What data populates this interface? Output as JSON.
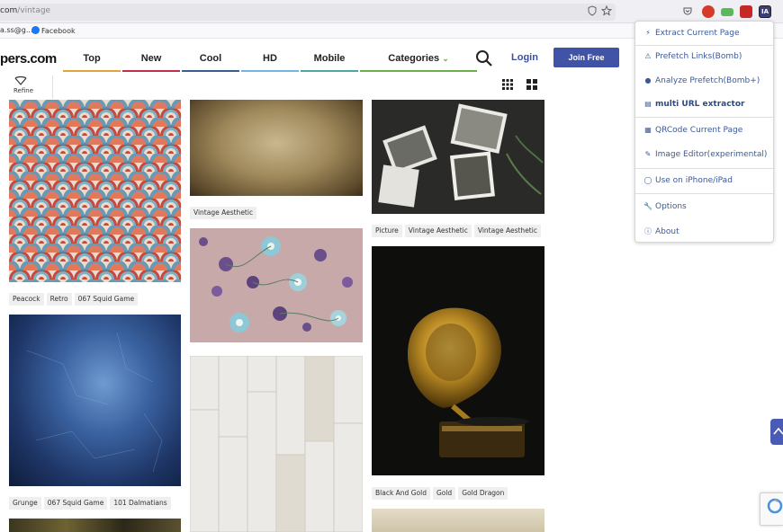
{
  "browser": {
    "url_host": "com",
    "url_path": "/vintage",
    "bookmarks": [
      "a.ss@g...",
      "Facebook"
    ]
  },
  "site": {
    "logo": "pers.com",
    "nav": [
      {
        "label": "Top",
        "color": "#e4a33a"
      },
      {
        "label": "New",
        "color": "#c0304a"
      },
      {
        "label": "Cool",
        "color": "#3a5e8f"
      },
      {
        "label": "HD",
        "color": "#73b4e0"
      },
      {
        "label": "Mobile",
        "color": "#4fa8a0"
      },
      {
        "label": "Categories",
        "color": "#6ab04c"
      }
    ],
    "login": "Login",
    "join": "Join Free",
    "refine": "Refine",
    "accent": "#4153a6"
  },
  "gallery": {
    "col1": [
      {
        "name": "peacock",
        "tags": [
          "Peacock",
          "Retro",
          "067 Squid Game"
        ]
      },
      {
        "name": "grunge",
        "tags": [
          "Grunge",
          "067 Squid Game",
          "101 Dalmatians"
        ]
      }
    ],
    "col2": [
      {
        "name": "parchment",
        "tags": [
          "Vintage Aesthetic"
        ]
      },
      {
        "name": "floral",
        "tags": []
      },
      {
        "name": "wood",
        "tags": []
      }
    ],
    "col3": [
      {
        "name": "photos",
        "tags": [
          "Picture",
          "Vintage Aesthetic",
          "Vintage Aesthetic"
        ]
      },
      {
        "name": "gramophone",
        "tags": [
          "Black And Gold",
          "Gold",
          "Gold Dragon"
        ]
      }
    ]
  },
  "ext_menu": {
    "items": [
      {
        "label": "Extract Current Page",
        "icon": "bolt-icon"
      },
      {
        "label": "Prefetch Links(Bomb)",
        "icon": "warning-icon"
      },
      {
        "label": "Analyze Prefetch(Bomb+)",
        "icon": "bomb-icon"
      },
      {
        "label": "multi URL extractor",
        "icon": "list-icon"
      },
      {
        "label": "QRCode Current Page",
        "icon": "qrcode-icon"
      },
      {
        "label": "Image Editor(experimental)",
        "icon": "edit-icon"
      },
      {
        "label": "Use on iPhone/iPad",
        "icon": "apple-icon"
      },
      {
        "label": "Options",
        "icon": "wrench-icon"
      },
      {
        "label": "About",
        "icon": "info-icon"
      }
    ]
  }
}
